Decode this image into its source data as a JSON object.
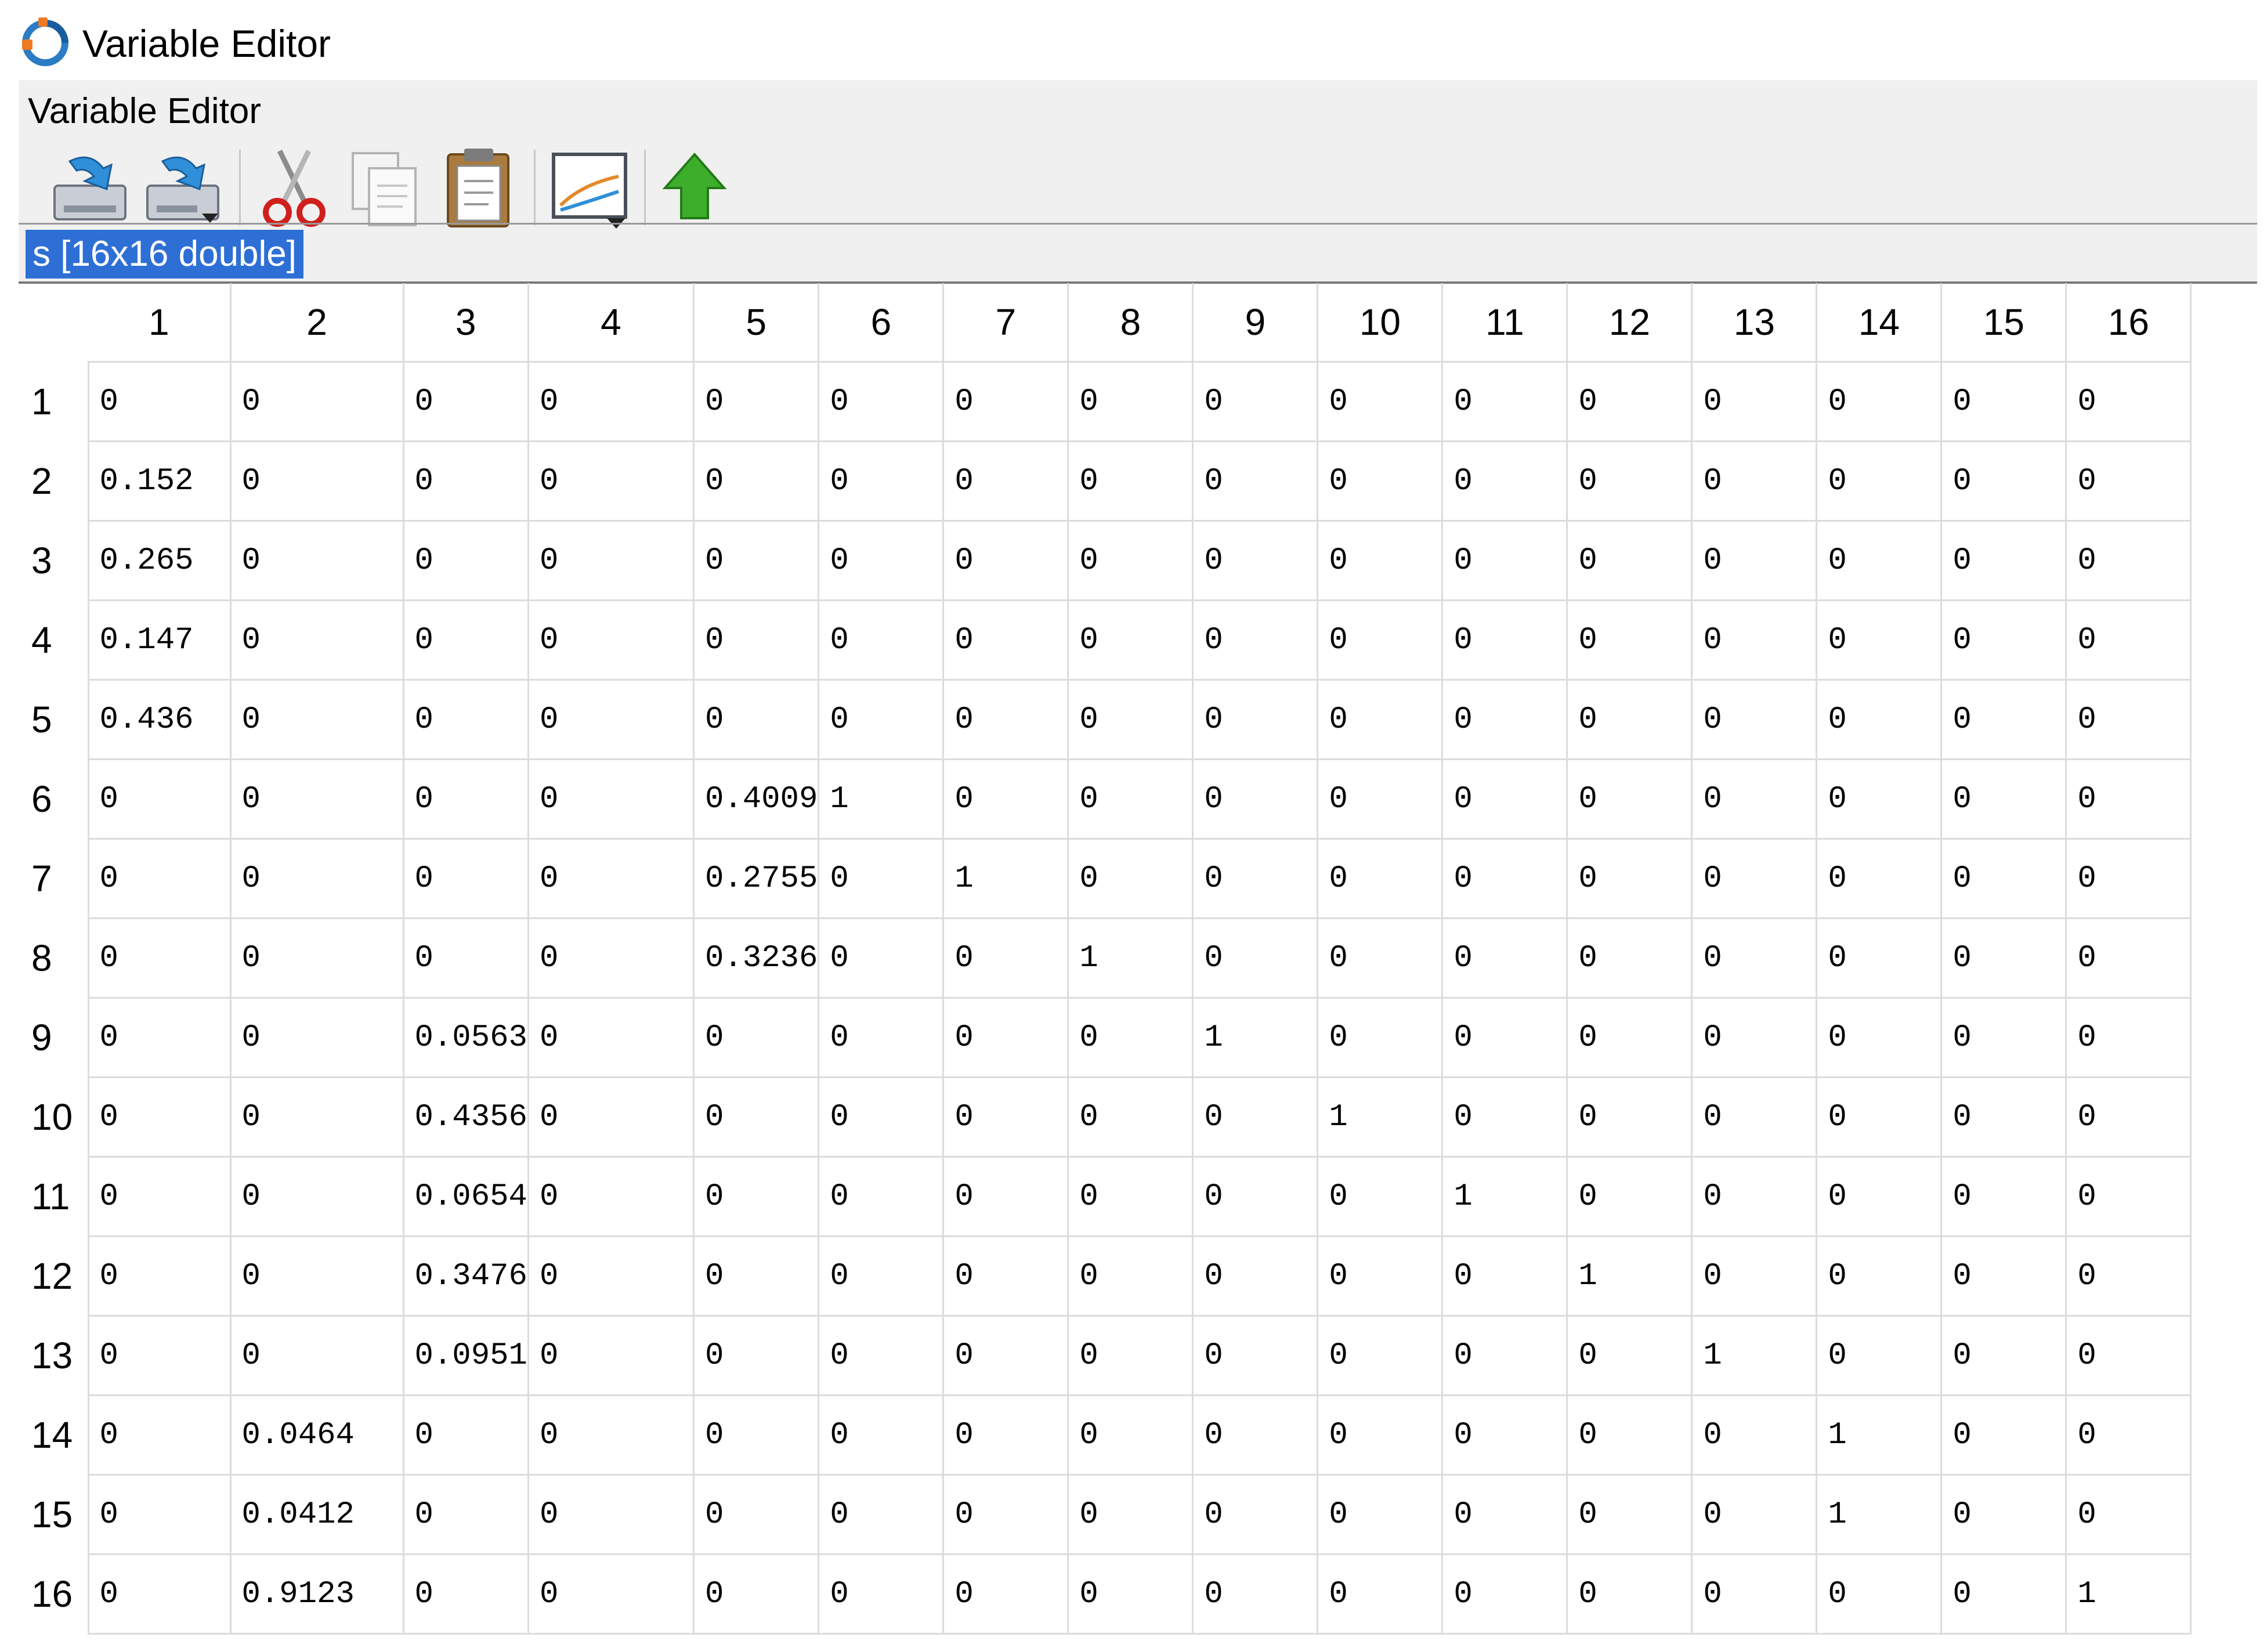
{
  "window": {
    "title": "Variable Editor",
    "icon": "octave-logo-icon"
  },
  "panel": {
    "title": "Variable Editor",
    "variable_label": "s [16x16 double]"
  },
  "toolbar": {
    "buttons": [
      {
        "name": "save-icon",
        "tooltip": ""
      },
      {
        "name": "save-as-icon",
        "tooltip": ""
      },
      {
        "name": "cut-icon",
        "tooltip": ""
      },
      {
        "name": "copy-icon",
        "tooltip": ""
      },
      {
        "name": "paste-icon",
        "tooltip": ""
      },
      {
        "name": "plot-icon",
        "tooltip": ""
      },
      {
        "name": "up-arrow-icon",
        "tooltip": ""
      }
    ]
  },
  "colors": {
    "selection": "#2e6fd6",
    "grid_line": "#dcdcdc",
    "toolbar_bg": "#f0f0f0"
  },
  "grid": {
    "columns": [
      "1",
      "2",
      "3",
      "4",
      "5",
      "6",
      "7",
      "8",
      "9",
      "10",
      "11",
      "12",
      "13",
      "14",
      "15",
      "16"
    ],
    "rows": [
      {
        "label": "1",
        "cells": [
          "0",
          "0",
          "0",
          "0",
          "0",
          "0",
          "0",
          "0",
          "0",
          "0",
          "0",
          "0",
          "0",
          "0",
          "0",
          "0"
        ]
      },
      {
        "label": "2",
        "cells": [
          "0.152",
          "0",
          "0",
          "0",
          "0",
          "0",
          "0",
          "0",
          "0",
          "0",
          "0",
          "0",
          "0",
          "0",
          "0",
          "0"
        ]
      },
      {
        "label": "3",
        "cells": [
          "0.265",
          "0",
          "0",
          "0",
          "0",
          "0",
          "0",
          "0",
          "0",
          "0",
          "0",
          "0",
          "0",
          "0",
          "0",
          "0"
        ]
      },
      {
        "label": "4",
        "cells": [
          "0.147",
          "0",
          "0",
          "0",
          "0",
          "0",
          "0",
          "0",
          "0",
          "0",
          "0",
          "0",
          "0",
          "0",
          "0",
          "0"
        ]
      },
      {
        "label": "5",
        "cells": [
          "0.436",
          "0",
          "0",
          "0",
          "0",
          "0",
          "0",
          "0",
          "0",
          "0",
          "0",
          "0",
          "0",
          "0",
          "0",
          "0"
        ]
      },
      {
        "label": "6",
        "cells": [
          "0",
          "0",
          "0",
          "0",
          "0.4009",
          "1",
          "0",
          "0",
          "0",
          "0",
          "0",
          "0",
          "0",
          "0",
          "0",
          "0"
        ]
      },
      {
        "label": "7",
        "cells": [
          "0",
          "0",
          "0",
          "0",
          "0.2755",
          "0",
          "1",
          "0",
          "0",
          "0",
          "0",
          "0",
          "0",
          "0",
          "0",
          "0"
        ]
      },
      {
        "label": "8",
        "cells": [
          "0",
          "0",
          "0",
          "0",
          "0.3236",
          "0",
          "0",
          "1",
          "0",
          "0",
          "0",
          "0",
          "0",
          "0",
          "0",
          "0"
        ]
      },
      {
        "label": "9",
        "cells": [
          "0",
          "0",
          "0.0563",
          "0",
          "0",
          "0",
          "0",
          "0",
          "1",
          "0",
          "0",
          "0",
          "0",
          "0",
          "0",
          "0"
        ]
      },
      {
        "label": "10",
        "cells": [
          "0",
          "0",
          "0.4356",
          "0",
          "0",
          "0",
          "0",
          "0",
          "0",
          "1",
          "0",
          "0",
          "0",
          "0",
          "0",
          "0"
        ]
      },
      {
        "label": "11",
        "cells": [
          "0",
          "0",
          "0.0654",
          "0",
          "0",
          "0",
          "0",
          "0",
          "0",
          "0",
          "1",
          "0",
          "0",
          "0",
          "0",
          "0"
        ]
      },
      {
        "label": "12",
        "cells": [
          "0",
          "0",
          "0.3476",
          "0",
          "0",
          "0",
          "0",
          "0",
          "0",
          "0",
          "0",
          "1",
          "0",
          "0",
          "0",
          "0"
        ]
      },
      {
        "label": "13",
        "cells": [
          "0",
          "0",
          "0.0951",
          "0",
          "0",
          "0",
          "0",
          "0",
          "0",
          "0",
          "0",
          "0",
          "1",
          "0",
          "0",
          "0"
        ]
      },
      {
        "label": "14",
        "cells": [
          "0",
          "0.0464",
          "0",
          "0",
          "0",
          "0",
          "0",
          "0",
          "0",
          "0",
          "0",
          "0",
          "0",
          "1",
          "0",
          "0"
        ]
      },
      {
        "label": "15",
        "cells": [
          "0",
          "0.0412",
          "0",
          "0",
          "0",
          "0",
          "0",
          "0",
          "0",
          "0",
          "0",
          "0",
          "0",
          "1",
          "0",
          "0"
        ]
      },
      {
        "label": "16",
        "cells": [
          "0",
          "0.9123",
          "0",
          "0",
          "0",
          "0",
          "0",
          "0",
          "0",
          "0",
          "0",
          "0",
          "0",
          "0",
          "0",
          "1"
        ]
      }
    ]
  }
}
